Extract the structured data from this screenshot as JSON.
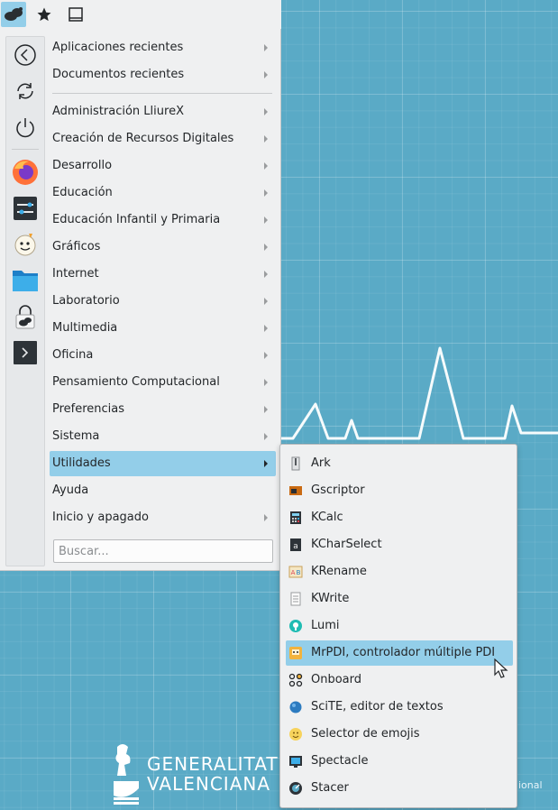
{
  "panel": {
    "buttons": [
      {
        "icon": "application-launcher-icon"
      },
      {
        "icon": "star-icon"
      },
      {
        "icon": "show-desktop-icon"
      }
    ]
  },
  "favorites": [
    {
      "icon": "back-arrow-icon"
    },
    {
      "icon": "refresh-icon"
    },
    {
      "icon": "power-icon"
    },
    {
      "icon": "firefox-icon"
    },
    {
      "icon": "settings-sliders-icon"
    },
    {
      "icon": "mascot-icon"
    },
    {
      "icon": "folder-icon"
    },
    {
      "icon": "lock-icon"
    },
    {
      "icon": "terminal-icon"
    }
  ],
  "menu": {
    "items": [
      {
        "label": "Aplicaciones recientes",
        "submenu": true
      },
      {
        "label": "Documentos recientes",
        "submenu": true
      },
      {
        "label": "Administración LliureX",
        "submenu": true
      },
      {
        "label": "Creación de Recursos Digitales",
        "submenu": true
      },
      {
        "label": "Desarrollo",
        "submenu": true
      },
      {
        "label": "Educación",
        "submenu": true
      },
      {
        "label": "Educación Infantil y Primaria",
        "submenu": true
      },
      {
        "label": "Gráficos",
        "submenu": true
      },
      {
        "label": "Internet",
        "submenu": true
      },
      {
        "label": "Laboratorio",
        "submenu": true
      },
      {
        "label": "Multimedia",
        "submenu": true
      },
      {
        "label": "Oficina",
        "submenu": true
      },
      {
        "label": "Pensamiento Computacional",
        "submenu": true
      },
      {
        "label": "Preferencias",
        "submenu": true
      },
      {
        "label": "Sistema",
        "submenu": true
      },
      {
        "label": "Utilidades",
        "submenu": true,
        "active": true
      },
      {
        "label": "Ayuda",
        "submenu": false
      },
      {
        "label": "Inicio y apagado",
        "submenu": true
      }
    ],
    "search_placeholder": "Buscar..."
  },
  "submenu": {
    "items": [
      {
        "label": "Ark",
        "icon": "archive-icon"
      },
      {
        "label": "Gscriptor",
        "icon": "gscriptor-icon"
      },
      {
        "label": "KCalc",
        "icon": "calculator-icon"
      },
      {
        "label": "KCharSelect",
        "icon": "character-select-icon"
      },
      {
        "label": "KRename",
        "icon": "rename-icon"
      },
      {
        "label": "KWrite",
        "icon": "text-editor-icon"
      },
      {
        "label": "Lumi",
        "icon": "lumi-icon"
      },
      {
        "label": "MrPDI, controlador múltiple PDI",
        "icon": "mrpdi-icon",
        "active": true
      },
      {
        "label": "Onboard",
        "icon": "keyboard-icon"
      },
      {
        "label": "SciTE, editor de textos",
        "icon": "scite-icon"
      },
      {
        "label": "Selector de emojis",
        "icon": "emoji-icon"
      },
      {
        "label": "Spectacle",
        "icon": "screenshot-icon"
      },
      {
        "label": "Stacer",
        "icon": "stacer-icon"
      }
    ]
  },
  "desktop": {
    "logo_line1": "GENERALITAT",
    "logo_line2": "VALENCIANA",
    "edge_text": "ional"
  },
  "colors": {
    "highlight": "#93cee9",
    "menu_bg": "#eff0f1",
    "desktop_bg": "#5aaac6"
  }
}
